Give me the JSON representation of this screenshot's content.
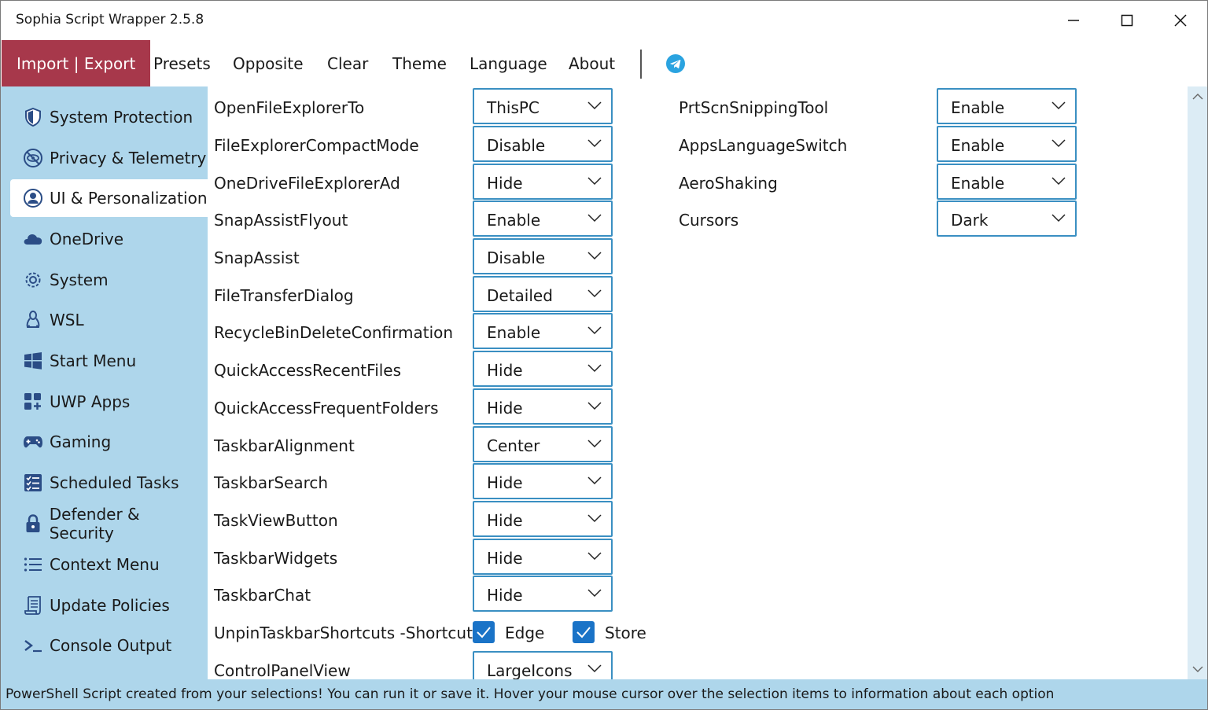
{
  "window": {
    "title": "Sophia Script Wrapper 2.5.8"
  },
  "menu": {
    "items": [
      "Import | Export",
      "Presets",
      "Opposite",
      "Clear",
      "Theme",
      "Language",
      "About"
    ],
    "active_color": "#a7384b"
  },
  "sidebar": {
    "bg_color": "#aed6eb",
    "items": [
      {
        "label": "System Protection",
        "icon": "shield-icon"
      },
      {
        "label": "Privacy & Telemetry",
        "icon": "eye-slash-icon"
      },
      {
        "label": "UI & Personalization",
        "icon": "user-icon",
        "active": true
      },
      {
        "label": "OneDrive",
        "icon": "cloud-icon"
      },
      {
        "label": "System",
        "icon": "gear-icon"
      },
      {
        "label": "WSL",
        "icon": "linux-icon"
      },
      {
        "label": "Start Menu",
        "icon": "windows-icon"
      },
      {
        "label": "UWP Apps",
        "icon": "apps-icon"
      },
      {
        "label": "Gaming",
        "icon": "gamepad-icon"
      },
      {
        "label": "Scheduled Tasks",
        "icon": "tasks-icon"
      },
      {
        "label": "Defender & Security",
        "icon": "lock-icon"
      },
      {
        "label": "Context Menu",
        "icon": "list-icon"
      },
      {
        "label": "Update Policies",
        "icon": "scroll-icon"
      },
      {
        "label": "Console Output",
        "icon": "terminal-icon"
      }
    ]
  },
  "settings_left": [
    {
      "label": "OpenFileExplorerTo",
      "value": "ThisPC"
    },
    {
      "label": "FileExplorerCompactMode",
      "value": "Disable"
    },
    {
      "label": "OneDriveFileExplorerAd",
      "value": "Hide"
    },
    {
      "label": "SnapAssistFlyout",
      "value": "Enable"
    },
    {
      "label": "SnapAssist",
      "value": "Disable"
    },
    {
      "label": "FileTransferDialog",
      "value": "Detailed"
    },
    {
      "label": "RecycleBinDeleteConfirmation",
      "value": "Enable"
    },
    {
      "label": "QuickAccessRecentFiles",
      "value": "Hide"
    },
    {
      "label": "QuickAccessFrequentFolders",
      "value": "Hide"
    },
    {
      "label": "TaskbarAlignment",
      "value": "Center"
    },
    {
      "label": "TaskbarSearch",
      "value": "Hide"
    },
    {
      "label": "TaskViewButton",
      "value": "Hide"
    },
    {
      "label": "TaskbarWidgets",
      "value": "Hide"
    },
    {
      "label": "TaskbarChat",
      "value": "Hide"
    }
  ],
  "unpin": {
    "label": "UnpinTaskbarShortcuts -Shortcuts",
    "options": [
      {
        "label": "Edge",
        "checked": true
      },
      {
        "label": "Store",
        "checked": true
      }
    ]
  },
  "control_panel": {
    "label": "ControlPanelView",
    "value": "LargeIcons"
  },
  "settings_right": [
    {
      "label": "PrtScnSnippingTool",
      "value": "Enable"
    },
    {
      "label": "AppsLanguageSwitch",
      "value": "Enable"
    },
    {
      "label": "AeroShaking",
      "value": "Enable"
    },
    {
      "label": "Cursors",
      "value": "Dark"
    }
  ],
  "status": {
    "message": "PowerShell Script created from your selections! You can run it or save it. Hover your mouse cursor over the selection items to information about each option"
  },
  "colors": {
    "accent": "#a7384b",
    "dropdown_border": "#3a8fc2",
    "checkbox": "#1a73c7",
    "telegram": "#2aa3e0"
  }
}
